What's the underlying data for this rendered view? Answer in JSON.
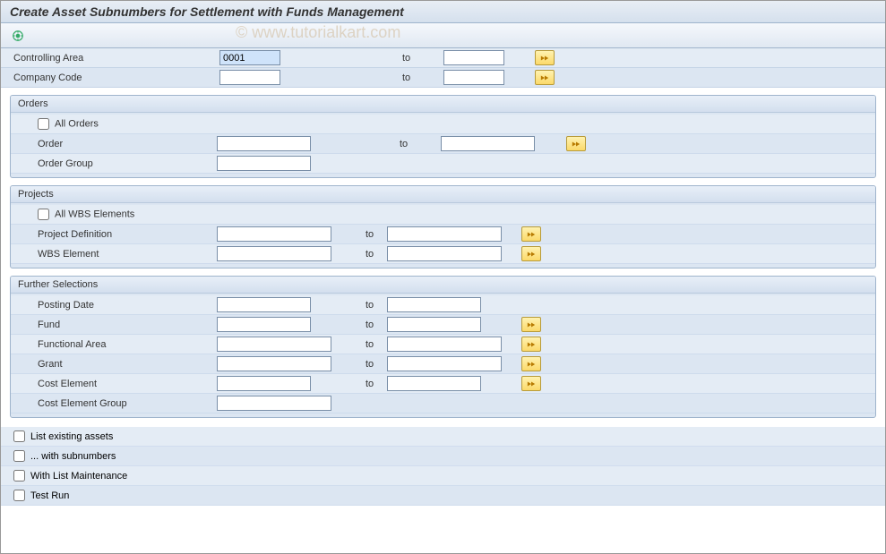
{
  "title": "Create Asset Subnumbers for Settlement with Funds Management",
  "watermark": "© www.tutorialkart.com",
  "top": {
    "controlling_area": {
      "label": "Controlling Area",
      "from": "0001",
      "to_label": "to",
      "to": ""
    },
    "company_code": {
      "label": "Company Code",
      "from": "",
      "to_label": "to",
      "to": ""
    }
  },
  "orders": {
    "title": "Orders",
    "all_orders": "All Orders",
    "order": {
      "label": "Order",
      "from": "",
      "to_label": "to",
      "to": ""
    },
    "order_group": {
      "label": "Order Group",
      "value": ""
    }
  },
  "projects": {
    "title": "Projects",
    "all_wbs": "All WBS Elements",
    "proj_def": {
      "label": "Project Definition",
      "from": "",
      "to_label": "to",
      "to": ""
    },
    "wbs": {
      "label": "WBS Element",
      "from": "",
      "to_label": "to",
      "to": ""
    }
  },
  "further": {
    "title": "Further Selections",
    "posting_date": {
      "label": "Posting Date",
      "from": "",
      "to_label": "to",
      "to": ""
    },
    "fund": {
      "label": "Fund",
      "from": "",
      "to_label": "to",
      "to": ""
    },
    "func_area": {
      "label": "Functional Area",
      "from": "",
      "to_label": "to",
      "to": ""
    },
    "grant": {
      "label": "Grant",
      "from": "",
      "to_label": "to",
      "to": ""
    },
    "cost_elem": {
      "label": "Cost Element",
      "from": "",
      "to_label": "to",
      "to": ""
    },
    "cost_elem_group": {
      "label": "Cost Element Group",
      "value": ""
    }
  },
  "options": {
    "list_existing": "List existing assets",
    "with_sub": "... with subnumbers",
    "list_maint": "With List Maintenance",
    "test_run": "Test Run"
  }
}
